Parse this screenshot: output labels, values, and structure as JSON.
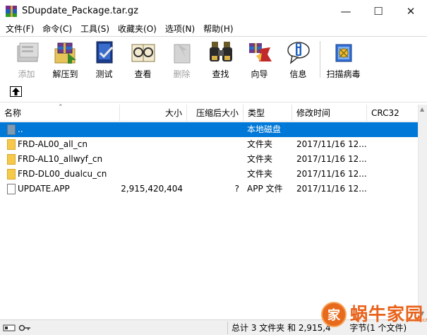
{
  "window": {
    "title": "SDupdate_Package.tar.gz",
    "minimize_glyph": "—",
    "maximize_glyph": "☐",
    "close_glyph": "✕"
  },
  "menu": [
    "文件(F)",
    "命令(C)",
    "工具(S)",
    "收藏夹(O)",
    "选项(N)",
    "帮助(H)"
  ],
  "toolbar": [
    {
      "label": "添加",
      "icon": "add-archive-icon",
      "enabled": false
    },
    {
      "label": "解压到",
      "icon": "extract-to-icon",
      "enabled": true
    },
    {
      "label": "测试",
      "icon": "test-icon",
      "enabled": true
    },
    {
      "label": "查看",
      "icon": "view-icon",
      "enabled": true
    },
    {
      "label": "删除",
      "icon": "delete-icon",
      "enabled": false
    },
    {
      "label": "查找",
      "icon": "find-binoculars-icon",
      "enabled": true
    },
    {
      "label": "向导",
      "icon": "wizard-icon",
      "enabled": true
    },
    {
      "label": "信息",
      "icon": "info-icon",
      "enabled": true
    },
    {
      "label": "扫描病毒",
      "icon": "virus-scan-icon",
      "enabled": true
    }
  ],
  "columns": {
    "name": "名称",
    "size": "大小",
    "packed": "压缩后大小",
    "type": "类型",
    "modified": "修改时间",
    "crc": "CRC32"
  },
  "files": [
    {
      "name": "..",
      "size": "",
      "packed": "",
      "type": "本地磁盘",
      "modified": "",
      "kind": "updir",
      "selected": true
    },
    {
      "name": "FRD-AL00_all_cn",
      "size": "",
      "packed": "",
      "type": "文件夹",
      "modified": "2017/11/16 12...",
      "kind": "folder",
      "selected": false
    },
    {
      "name": "FRD-AL10_allwyf_cn",
      "size": "",
      "packed": "",
      "type": "文件夹",
      "modified": "2017/11/16 12...",
      "kind": "folder",
      "selected": false
    },
    {
      "name": "FRD-DL00_dualcu_cn",
      "size": "",
      "packed": "",
      "type": "文件夹",
      "modified": "2017/11/16 12...",
      "kind": "folder",
      "selected": false
    },
    {
      "name": "UPDATE.APP",
      "size": "2,915,420,404",
      "packed": "?",
      "type": "APP 文件",
      "modified": "2017/11/16 12...",
      "kind": "file",
      "selected": false
    }
  ],
  "status": {
    "text": "总计 3 文件夹 和 2,915,4       字节(1 个文件)"
  },
  "watermark": {
    "logo_char": "家",
    "text": "蜗牛家园",
    "suffix": "m.cn"
  }
}
